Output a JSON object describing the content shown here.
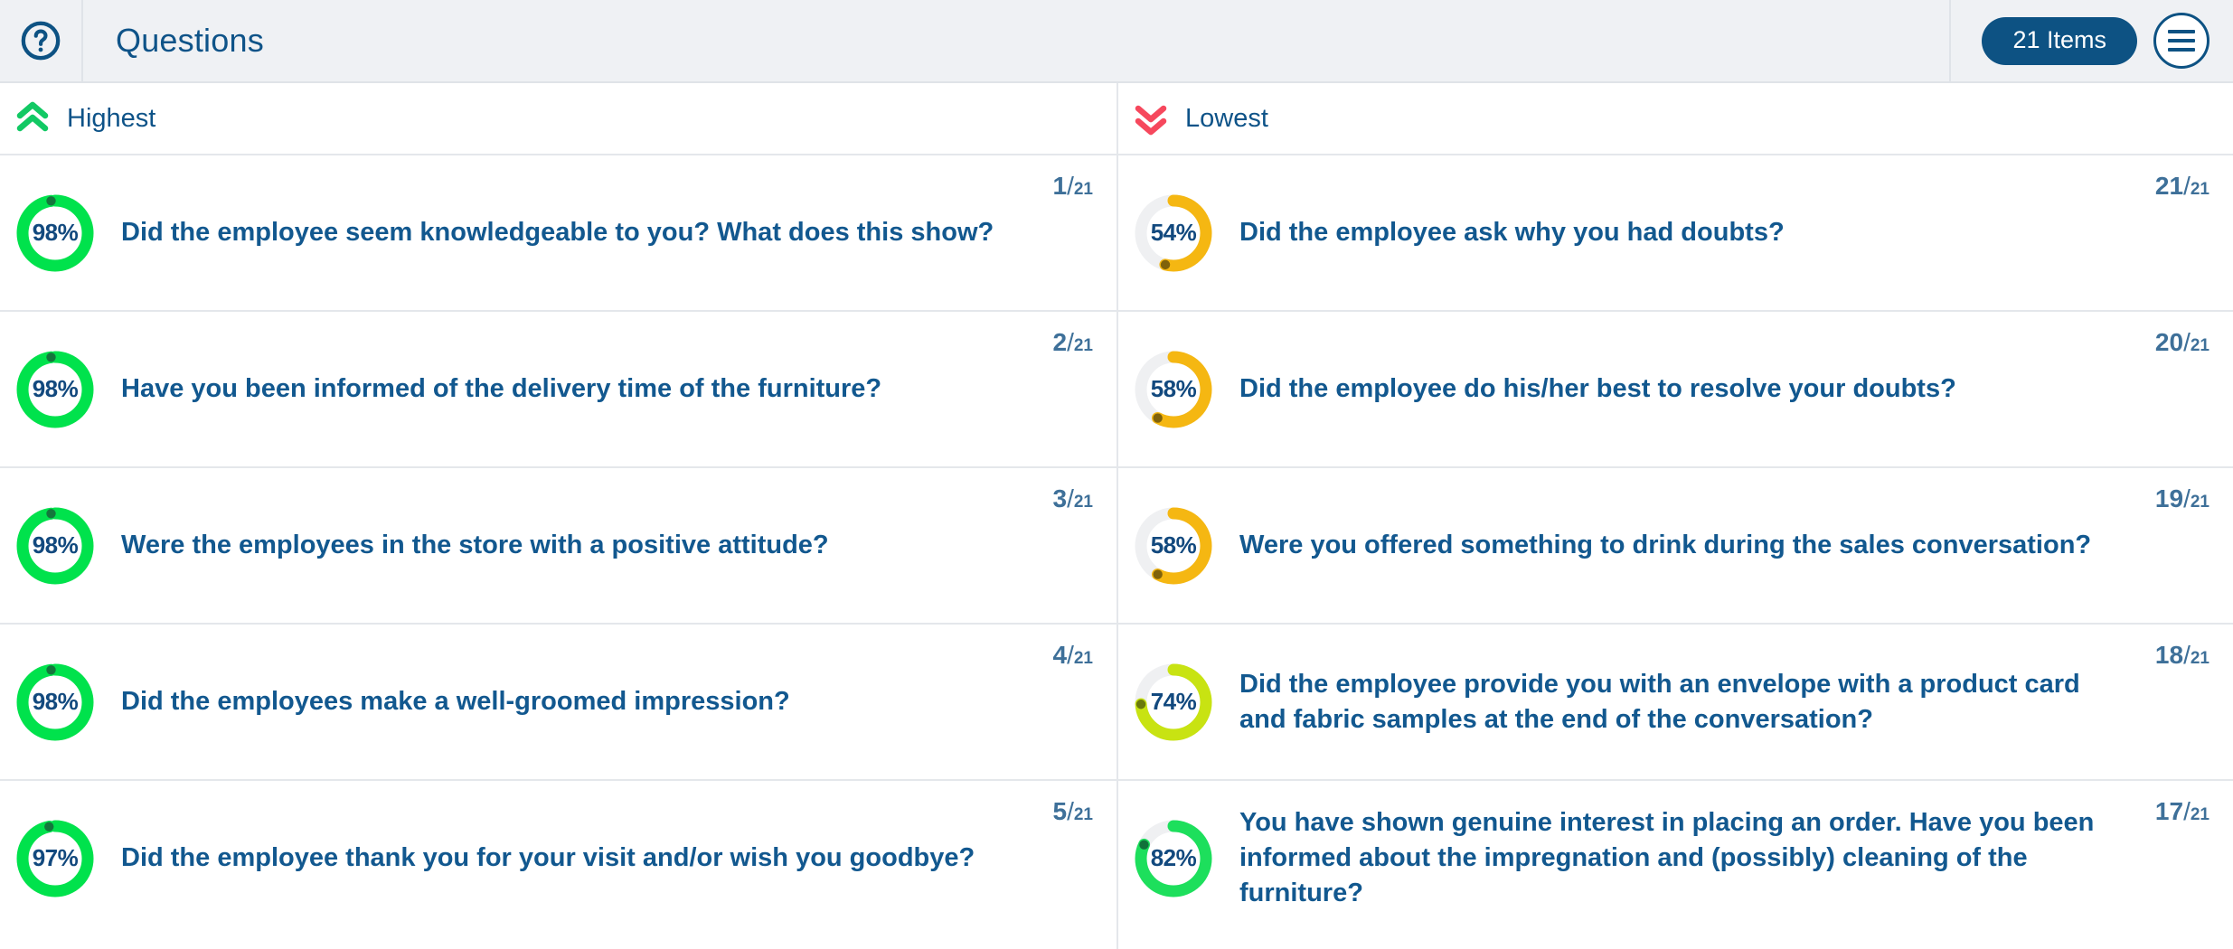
{
  "header": {
    "help_icon": "question-circle-icon",
    "title": "Questions",
    "items_badge": "21 Items",
    "menu_icon": "hamburger-menu-icon"
  },
  "colors": {
    "brand_blue": "#0d5283",
    "text_blue": "#12588f",
    "green": "#00e24c",
    "green_soft": "#1ddf5c",
    "chartreuse": "#c8e312",
    "amber": "#f5b712",
    "track": "#eff0f2",
    "highest_chevron": "#12c964",
    "lowest_chevron": "#f6485d"
  },
  "columns": [
    {
      "id": "highest",
      "label": "Highest",
      "icon": "chevron-double-up-icon",
      "icon_color": "#12c964",
      "rows": [
        {
          "percent": 98,
          "percent_label": "98%",
          "color": "#00e24c",
          "dot_color": "#14763c",
          "question": "Did the employee seem knowledgeable to you? What does this show?",
          "rank": "1",
          "total": "21"
        },
        {
          "percent": 98,
          "percent_label": "98%",
          "color": "#00e24c",
          "dot_color": "#14763c",
          "question": "Have you been informed of the delivery time of the furniture?",
          "rank": "2",
          "total": "21"
        },
        {
          "percent": 98,
          "percent_label": "98%",
          "color": "#00e24c",
          "dot_color": "#14763c",
          "question": "Were the employees in the store with a positive attitude?",
          "rank": "3",
          "total": "21"
        },
        {
          "percent": 98,
          "percent_label": "98%",
          "color": "#00e24c",
          "dot_color": "#14763c",
          "question": "Did the employees make a well-groomed impression?",
          "rank": "4",
          "total": "21"
        },
        {
          "percent": 97,
          "percent_label": "97%",
          "color": "#00e24c",
          "dot_color": "#14763c",
          "question": "Did the employee thank you for your visit and/or wish you goodbye?",
          "rank": "5",
          "total": "21"
        }
      ]
    },
    {
      "id": "lowest",
      "label": "Lowest",
      "icon": "chevron-double-down-icon",
      "icon_color": "#f6485d",
      "rows": [
        {
          "percent": 54,
          "percent_label": "54%",
          "color": "#f5b712",
          "dot_color": "#80620b",
          "question": "Did the employee ask why you had doubts?",
          "rank": "21",
          "total": "21"
        },
        {
          "percent": 58,
          "percent_label": "58%",
          "color": "#f5b712",
          "dot_color": "#80620b",
          "question": "Did the employee do his/her best to resolve your doubts?",
          "rank": "20",
          "total": "21"
        },
        {
          "percent": 58,
          "percent_label": "58%",
          "color": "#f5b712",
          "dot_color": "#80620b",
          "question": "Were you offered something to drink during the sales conversation?",
          "rank": "19",
          "total": "21"
        },
        {
          "percent": 74,
          "percent_label": "74%",
          "color": "#c8e312",
          "dot_color": "#6b7a0b",
          "question": "Did the employee provide you with an envelope with a product card and fabric samples at the end of the conversation?",
          "rank": "18",
          "total": "21"
        },
        {
          "percent": 82,
          "percent_label": "82%",
          "color": "#1ddf5c",
          "dot_color": "#11703a",
          "question": "You have shown genuine interest in placing an order. Have you been informed about the impregnation and (possibly) cleaning of the furniture?",
          "rank": "17",
          "total": "21"
        }
      ]
    }
  ]
}
